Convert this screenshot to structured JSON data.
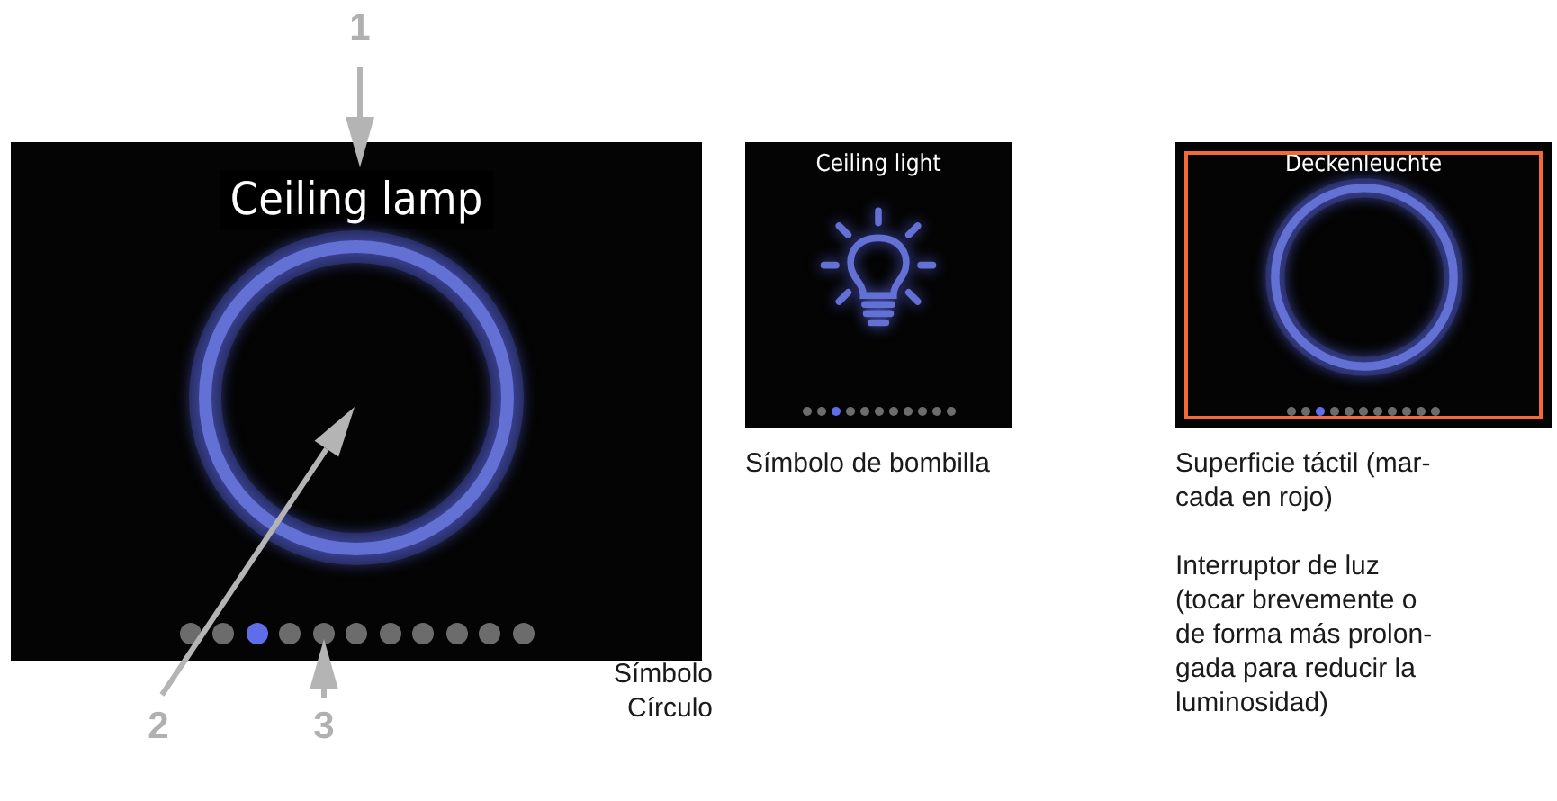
{
  "screens": [
    {
      "kind": "ring",
      "title": "Ceiling lamp",
      "touch_area_marked": false,
      "dots": [
        {
          "selected": false
        },
        {
          "selected": false
        },
        {
          "selected": true
        },
        {
          "selected": false
        },
        {
          "selected": false
        },
        {
          "selected": false
        },
        {
          "selected": false
        },
        {
          "selected": false
        },
        {
          "selected": false
        },
        {
          "selected": false
        },
        {
          "selected": false
        }
      ],
      "caption": "Símbolo\nCírculo"
    },
    {
      "kind": "bulb",
      "title": "Ceiling light",
      "touch_area_marked": false,
      "dots": [
        {
          "selected": false
        },
        {
          "selected": false
        },
        {
          "selected": true
        },
        {
          "selected": false
        },
        {
          "selected": false
        },
        {
          "selected": false
        },
        {
          "selected": false
        },
        {
          "selected": false
        },
        {
          "selected": false
        },
        {
          "selected": false
        },
        {
          "selected": false
        }
      ],
      "caption": "Símbolo de bombilla"
    },
    {
      "kind": "ring",
      "title": "Deckenleuchte",
      "touch_area_marked": true,
      "dots": [
        {
          "selected": false
        },
        {
          "selected": false
        },
        {
          "selected": true
        },
        {
          "selected": false
        },
        {
          "selected": false
        },
        {
          "selected": false
        },
        {
          "selected": false
        },
        {
          "selected": false
        },
        {
          "selected": false
        },
        {
          "selected": false
        },
        {
          "selected": false
        }
      ],
      "caption": "Superficie táctil (mar-\ncada en rojo)\n\nInterruptor de luz\n(tocar brevemente o\nde forma más prolon-\ngada para reducir la\nluminosidad)"
    }
  ],
  "callouts": [
    "1",
    "2",
    "3"
  ]
}
